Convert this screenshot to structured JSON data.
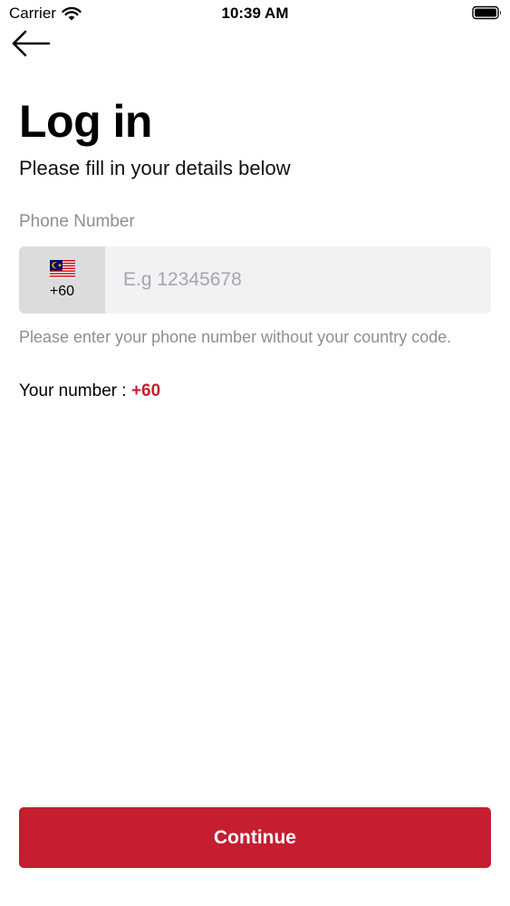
{
  "status_bar": {
    "carrier": "Carrier",
    "time": "10:39 AM"
  },
  "header": {
    "back_icon": "arrow-left-icon"
  },
  "login": {
    "title": "Log in",
    "subtitle": "Please fill in your details below",
    "phone_label": "Phone Number",
    "country_flag": "malaysia-flag-icon",
    "country_code": "+60",
    "phone_value": "",
    "phone_placeholder": "E.g 12345678",
    "helper_text": "Please enter your phone number without your country code.",
    "your_number_label": "Your number :",
    "your_number_value": "+60"
  },
  "footer": {
    "continue_label": "Continue"
  },
  "colors": {
    "accent": "#c41e30",
    "muted_text": "#8e8e93",
    "field_bg": "#f2f2f4",
    "picker_bg": "#dcdcde"
  }
}
